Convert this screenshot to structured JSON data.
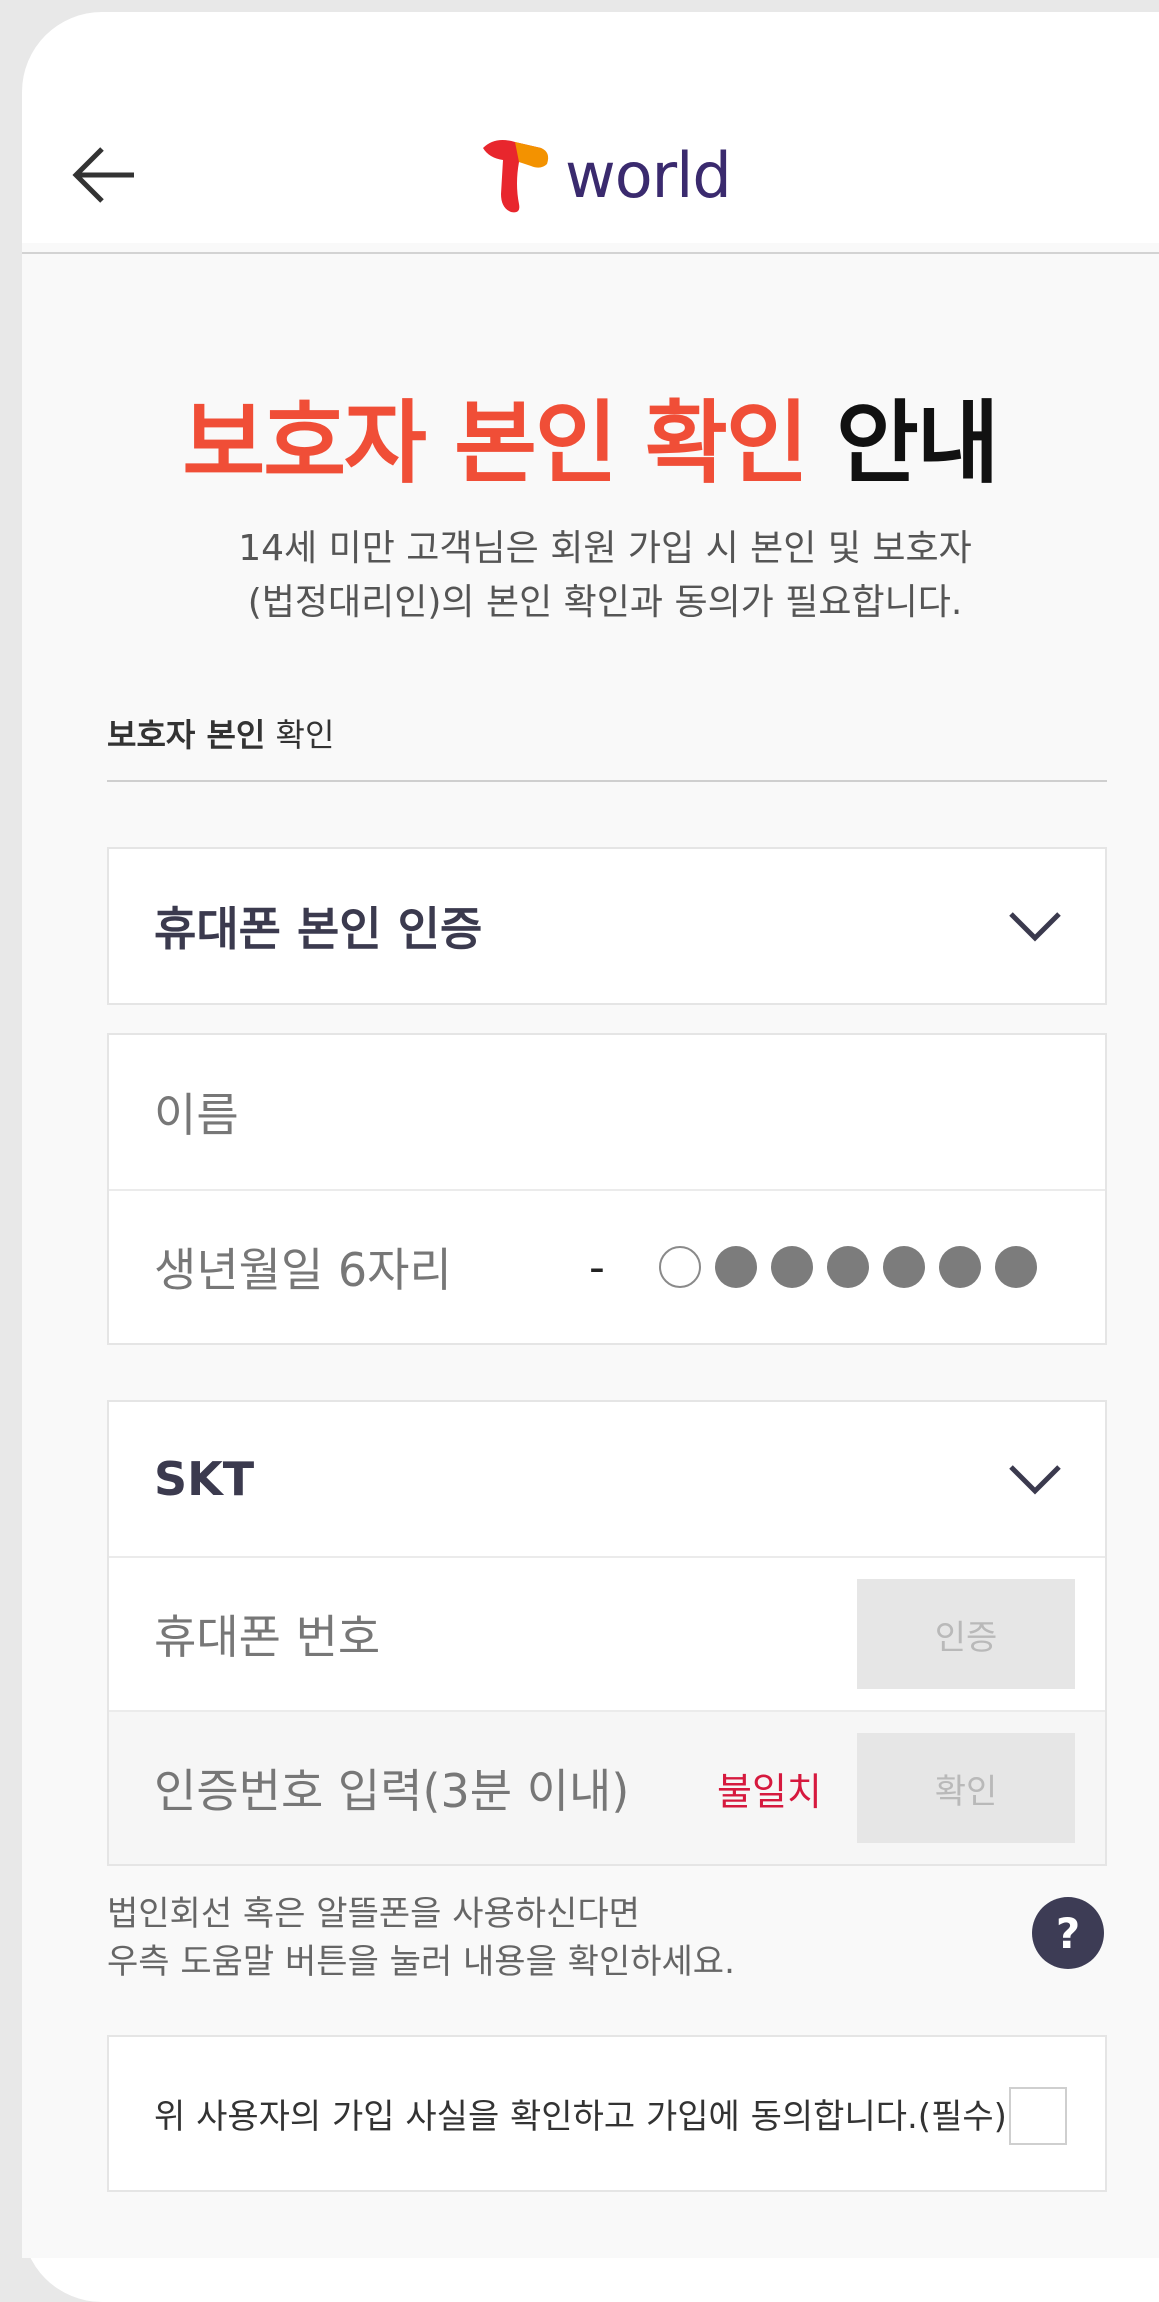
{
  "header": {
    "logo_text": "world",
    "back_icon": "arrow-left-icon"
  },
  "title": {
    "highlight": "보호자 본인 확인",
    "rest": "안내"
  },
  "description": {
    "line1": "14세 미만 고객님은 회원 가입 시 본인 및 보호자",
    "line2": "(법정대리인)의 본인 확인과 동의가 필요합니다."
  },
  "section_label": {
    "bold": "보호자 본인",
    "normal": "확인"
  },
  "auth_method": {
    "selected": "휴대폰 본인 인증"
  },
  "identity": {
    "name_placeholder": "이름",
    "birth_placeholder": "생년월일 6자리",
    "dash": "-"
  },
  "phone": {
    "carrier": "SKT",
    "number_placeholder": "휴대폰 번호",
    "request_button": "인증",
    "code_placeholder": "인증번호 입력(3분 이내)",
    "mismatch_text": "불일치",
    "confirm_button": "확인"
  },
  "help": {
    "line1": "법인회선 혹은 알뜰폰을 사용하신다면",
    "line2": "우측 도움말 버튼을 눌러 내용을 확인하세요.",
    "button": "?"
  },
  "agreement": {
    "text": "위 사용자의 가입 사실을 확인하고 가입에 동의합니다.(필수)",
    "checked": false
  },
  "colors": {
    "accent": "#f04e37",
    "error": "#d6193e",
    "help_button": "#3d3c55"
  }
}
